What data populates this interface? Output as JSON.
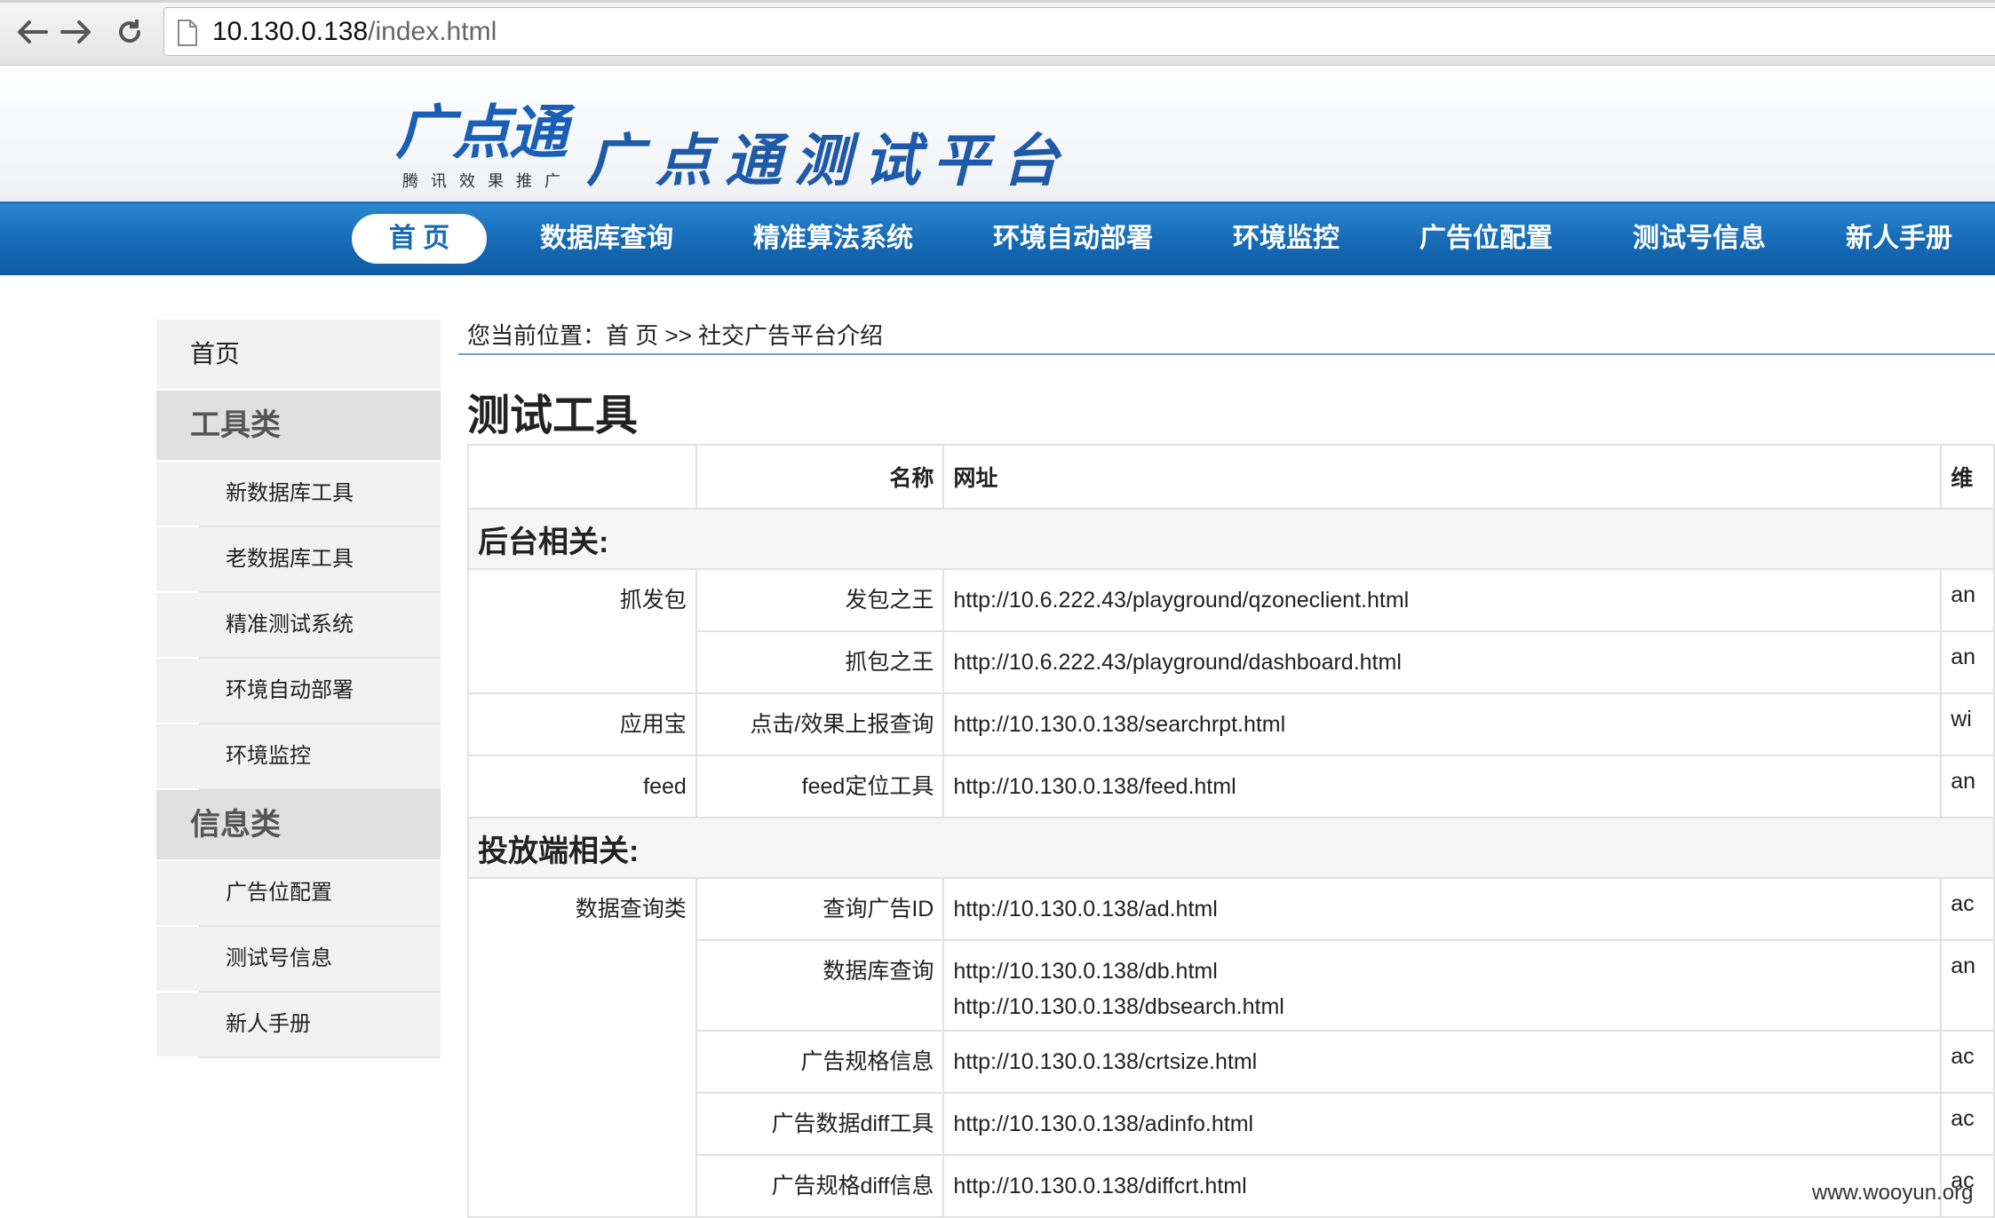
{
  "browser": {
    "url_host": "10.130.0.138",
    "url_path": "/index.html",
    "icons": {
      "back": "arrow-left-icon",
      "forward": "arrow-right-icon",
      "reload": "reload-icon",
      "page": "page-icon"
    }
  },
  "header": {
    "logo_text": "广点通",
    "logo_sub": "腾讯效果推广",
    "site_title": "广点通测试平台",
    "brand_color": "#1668b3"
  },
  "mainnav": [
    {
      "label": "首 页",
      "active": true
    },
    {
      "label": "数据库查询"
    },
    {
      "label": "精准算法系统"
    },
    {
      "label": "环境自动部署"
    },
    {
      "label": "环境监控"
    },
    {
      "label": "广告位配置"
    },
    {
      "label": "测试号信息"
    },
    {
      "label": "新人手册"
    }
  ],
  "sidebar": {
    "home": "首页",
    "categories": [
      {
        "title": "工具类",
        "items": [
          "新数据库工具",
          "老数据库工具",
          "精准测试系统",
          "环境自动部署",
          "环境监控"
        ]
      },
      {
        "title": "信息类",
        "items": [
          "广告位配置",
          "测试号信息",
          "新人手册"
        ]
      }
    ]
  },
  "breadcrumb": "您当前位置：首 页 >> 社交广告平台介绍",
  "content": {
    "title": "测试工具",
    "table": {
      "headers": [
        "",
        "名称",
        "网址",
        "维"
      ],
      "sections": [
        {
          "title": "后台相关:",
          "rows": [
            {
              "group": "抓发包",
              "name": "发包之王",
              "urls": [
                "http://10.6.222.43/playground/qzoneclient.html"
              ],
              "maint": "an"
            },
            {
              "group": "",
              "name": "抓包之王",
              "urls": [
                "http://10.6.222.43/playground/dashboard.html"
              ],
              "maint": "an"
            },
            {
              "group": "应用宝",
              "name": "点击/效果上报查询",
              "urls": [
                "http://10.130.0.138/searchrpt.html"
              ],
              "maint": "wi"
            },
            {
              "group": "feed",
              "name": "feed定位工具",
              "urls": [
                "http://10.130.0.138/feed.html"
              ],
              "maint": "an"
            }
          ]
        },
        {
          "title": "投放端相关:",
          "rows": [
            {
              "group": "数据查询类",
              "name": "查询广告ID",
              "urls": [
                "http://10.130.0.138/ad.html"
              ],
              "maint": "ac"
            },
            {
              "group": "",
              "name": "数据库查询",
              "urls": [
                "http://10.130.0.138/db.html",
                "http://10.130.0.138/dbsearch.html"
              ],
              "maint": "an"
            },
            {
              "group": "",
              "name": "广告规格信息",
              "urls": [
                "http://10.130.0.138/crtsize.html"
              ],
              "maint": "ac"
            },
            {
              "group": "",
              "name": "广告数据diff工具",
              "urls": [
                "http://10.130.0.138/adinfo.html"
              ],
              "maint": "ac"
            },
            {
              "group": "",
              "name": "广告规格diff信息",
              "urls": [
                "http://10.130.0.138/diffcrt.html"
              ],
              "maint": "ac"
            }
          ]
        }
      ]
    }
  },
  "watermark": "www.wooyun.org"
}
